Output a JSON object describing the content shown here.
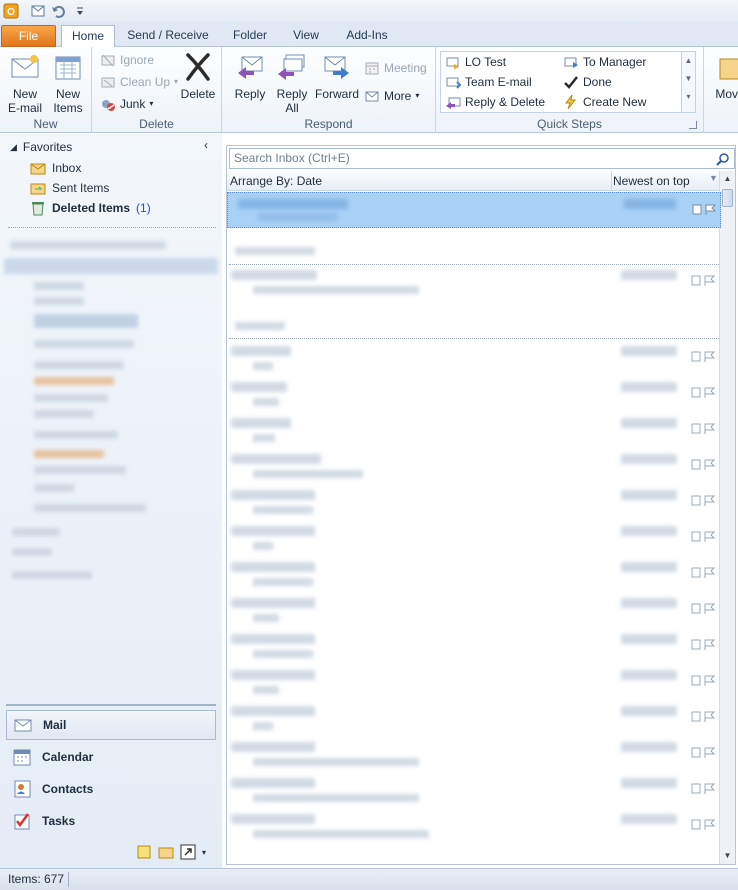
{
  "tabs": {
    "file": "File",
    "home": "Home",
    "send_receive": "Send / Receive",
    "folder": "Folder",
    "view": "View",
    "add_ins": "Add-Ins"
  },
  "ribbon": {
    "new_group": {
      "new_email": "New\nE-mail",
      "new_items": "New\nItems",
      "label": "New"
    },
    "delete_group": {
      "ignore": "Ignore",
      "clean_up": "Clean Up",
      "junk": "Junk",
      "delete": "Delete",
      "label": "Delete"
    },
    "respond_group": {
      "reply": "Reply",
      "reply_all": "Reply\nAll",
      "forward": "Forward",
      "meeting": "Meeting",
      "more": "More",
      "label": "Respond"
    },
    "quick_steps": {
      "lo_test": "LO Test",
      "to_manager": "To Manager",
      "team_email": "Team E-mail",
      "done": "Done",
      "reply_delete": "Reply & Delete",
      "create_new": "Create New",
      "label": "Quick Steps"
    },
    "move_group": {
      "move": "Move"
    }
  },
  "nav": {
    "favorites": "Favorites",
    "inbox": "Inbox",
    "sent_items": "Sent Items",
    "deleted_items": "Deleted Items",
    "deleted_count": "(1)",
    "mail": "Mail",
    "calendar": "Calendar",
    "contacts": "Contacts",
    "tasks": "Tasks"
  },
  "list": {
    "search_placeholder": "Search Inbox (Ctrl+E)",
    "arrange_by": "Arrange By: Date",
    "sort_order": "Newest on top"
  },
  "status": {
    "items": "Items: 677"
  },
  "colors": {
    "accent": "#9ec8f3",
    "file_tab": "#e8821f",
    "selected_row": "#a9d0f5"
  }
}
